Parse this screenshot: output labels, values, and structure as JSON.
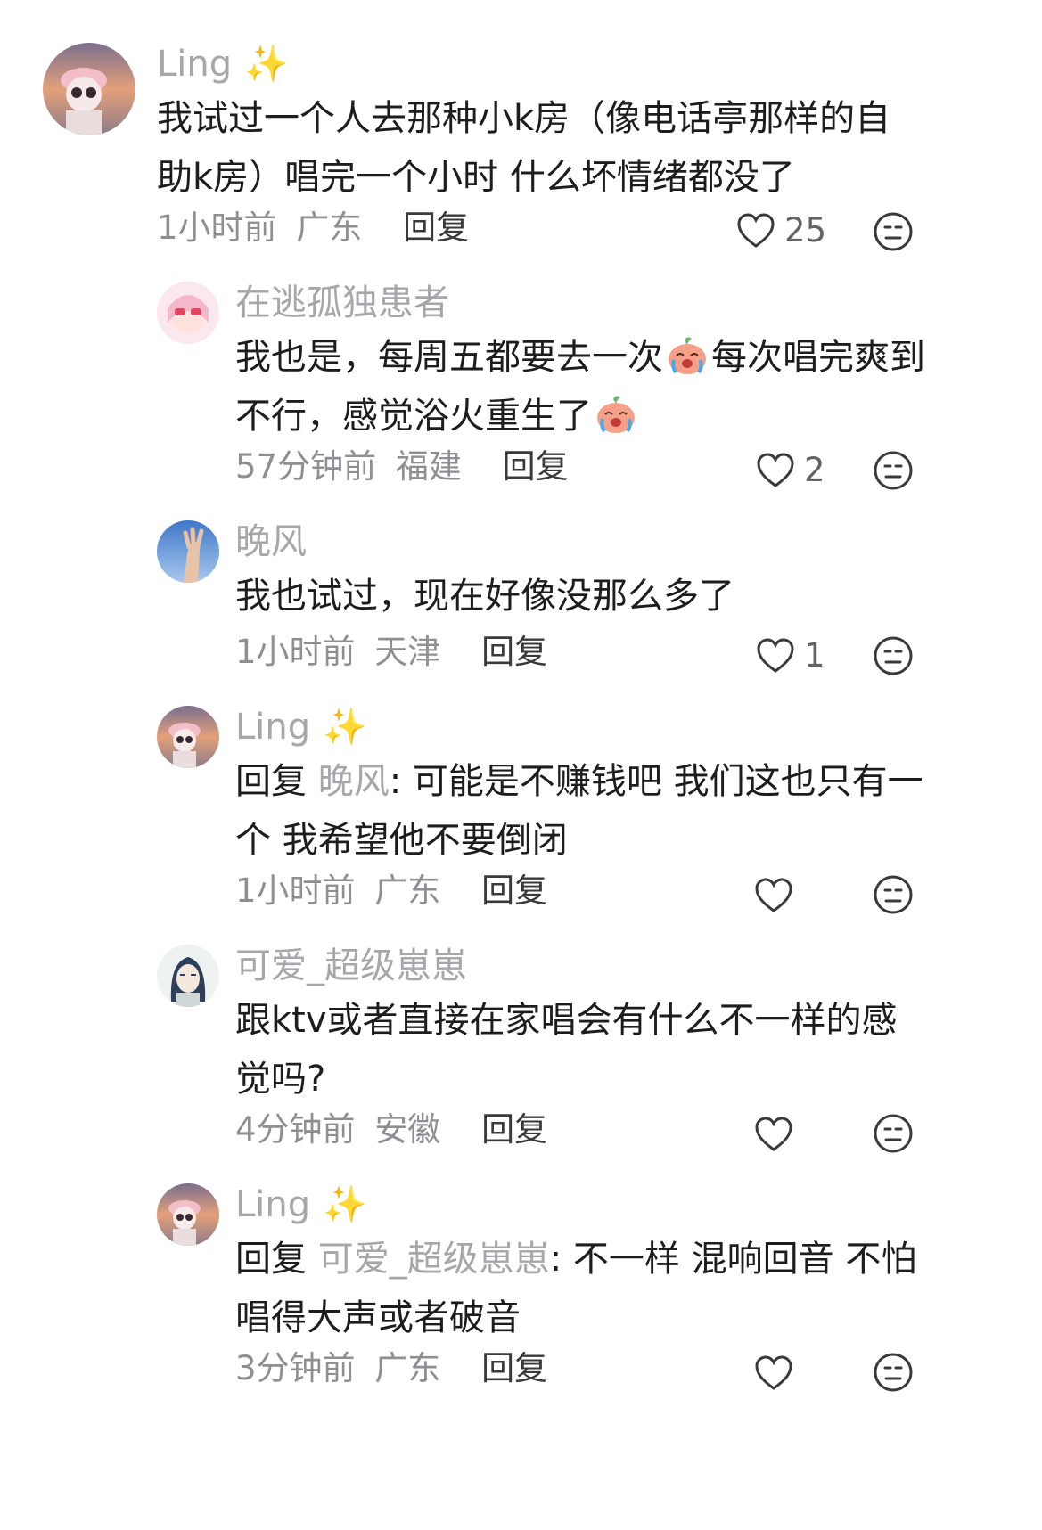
{
  "comments": [
    {
      "username": "Ling",
      "sparkle": "✨",
      "lines": [
        "我试过一个人去那种小k房（像电话亭那样的自",
        "助k房）唱完一个小时 什么坏情绪都没了"
      ],
      "time": "1小时前",
      "location": "广东",
      "reply_label": "回复",
      "like_count": "25"
    },
    {
      "username": "在逃孤独患者",
      "line1_a": "我也是，每周五都要去一次",
      "line1_b": "每次唱完爽到",
      "line2": "不行，感觉浴火重生了",
      "time": "57分钟前",
      "location": "福建",
      "reply_label": "回复",
      "like_count": "2"
    },
    {
      "username": "晚风",
      "lines": [
        "我也试过，现在好像没那么多了"
      ],
      "time": "1小时前",
      "location": "天津",
      "reply_label": "回复",
      "like_count": "1"
    },
    {
      "username": "Ling",
      "sparkle": "✨",
      "reply_prefix": "回复 ",
      "reply_target": "晚风",
      "line1_rest": ": 可能是不赚钱吧 我们这也只有一",
      "line2": "个 我希望他不要倒闭",
      "time": "1小时前",
      "location": "广东",
      "reply_label": "回复",
      "like_count": ""
    },
    {
      "username": "可爱_超级崽崽",
      "lines": [
        "跟ktv或者直接在家唱会有什么不一样的感",
        "觉吗?"
      ],
      "time": "4分钟前",
      "location": "安徽",
      "reply_label": "回复",
      "like_count": ""
    },
    {
      "username": "Ling",
      "sparkle": "✨",
      "reply_prefix": "回复 ",
      "reply_target": "可爱_超级崽崽",
      "line1_rest": ": 不一样 混响回音 不怕",
      "line2": "唱得大声或者破音",
      "time": "3分钟前",
      "location": "广东",
      "reply_label": "回复",
      "like_count": ""
    }
  ]
}
